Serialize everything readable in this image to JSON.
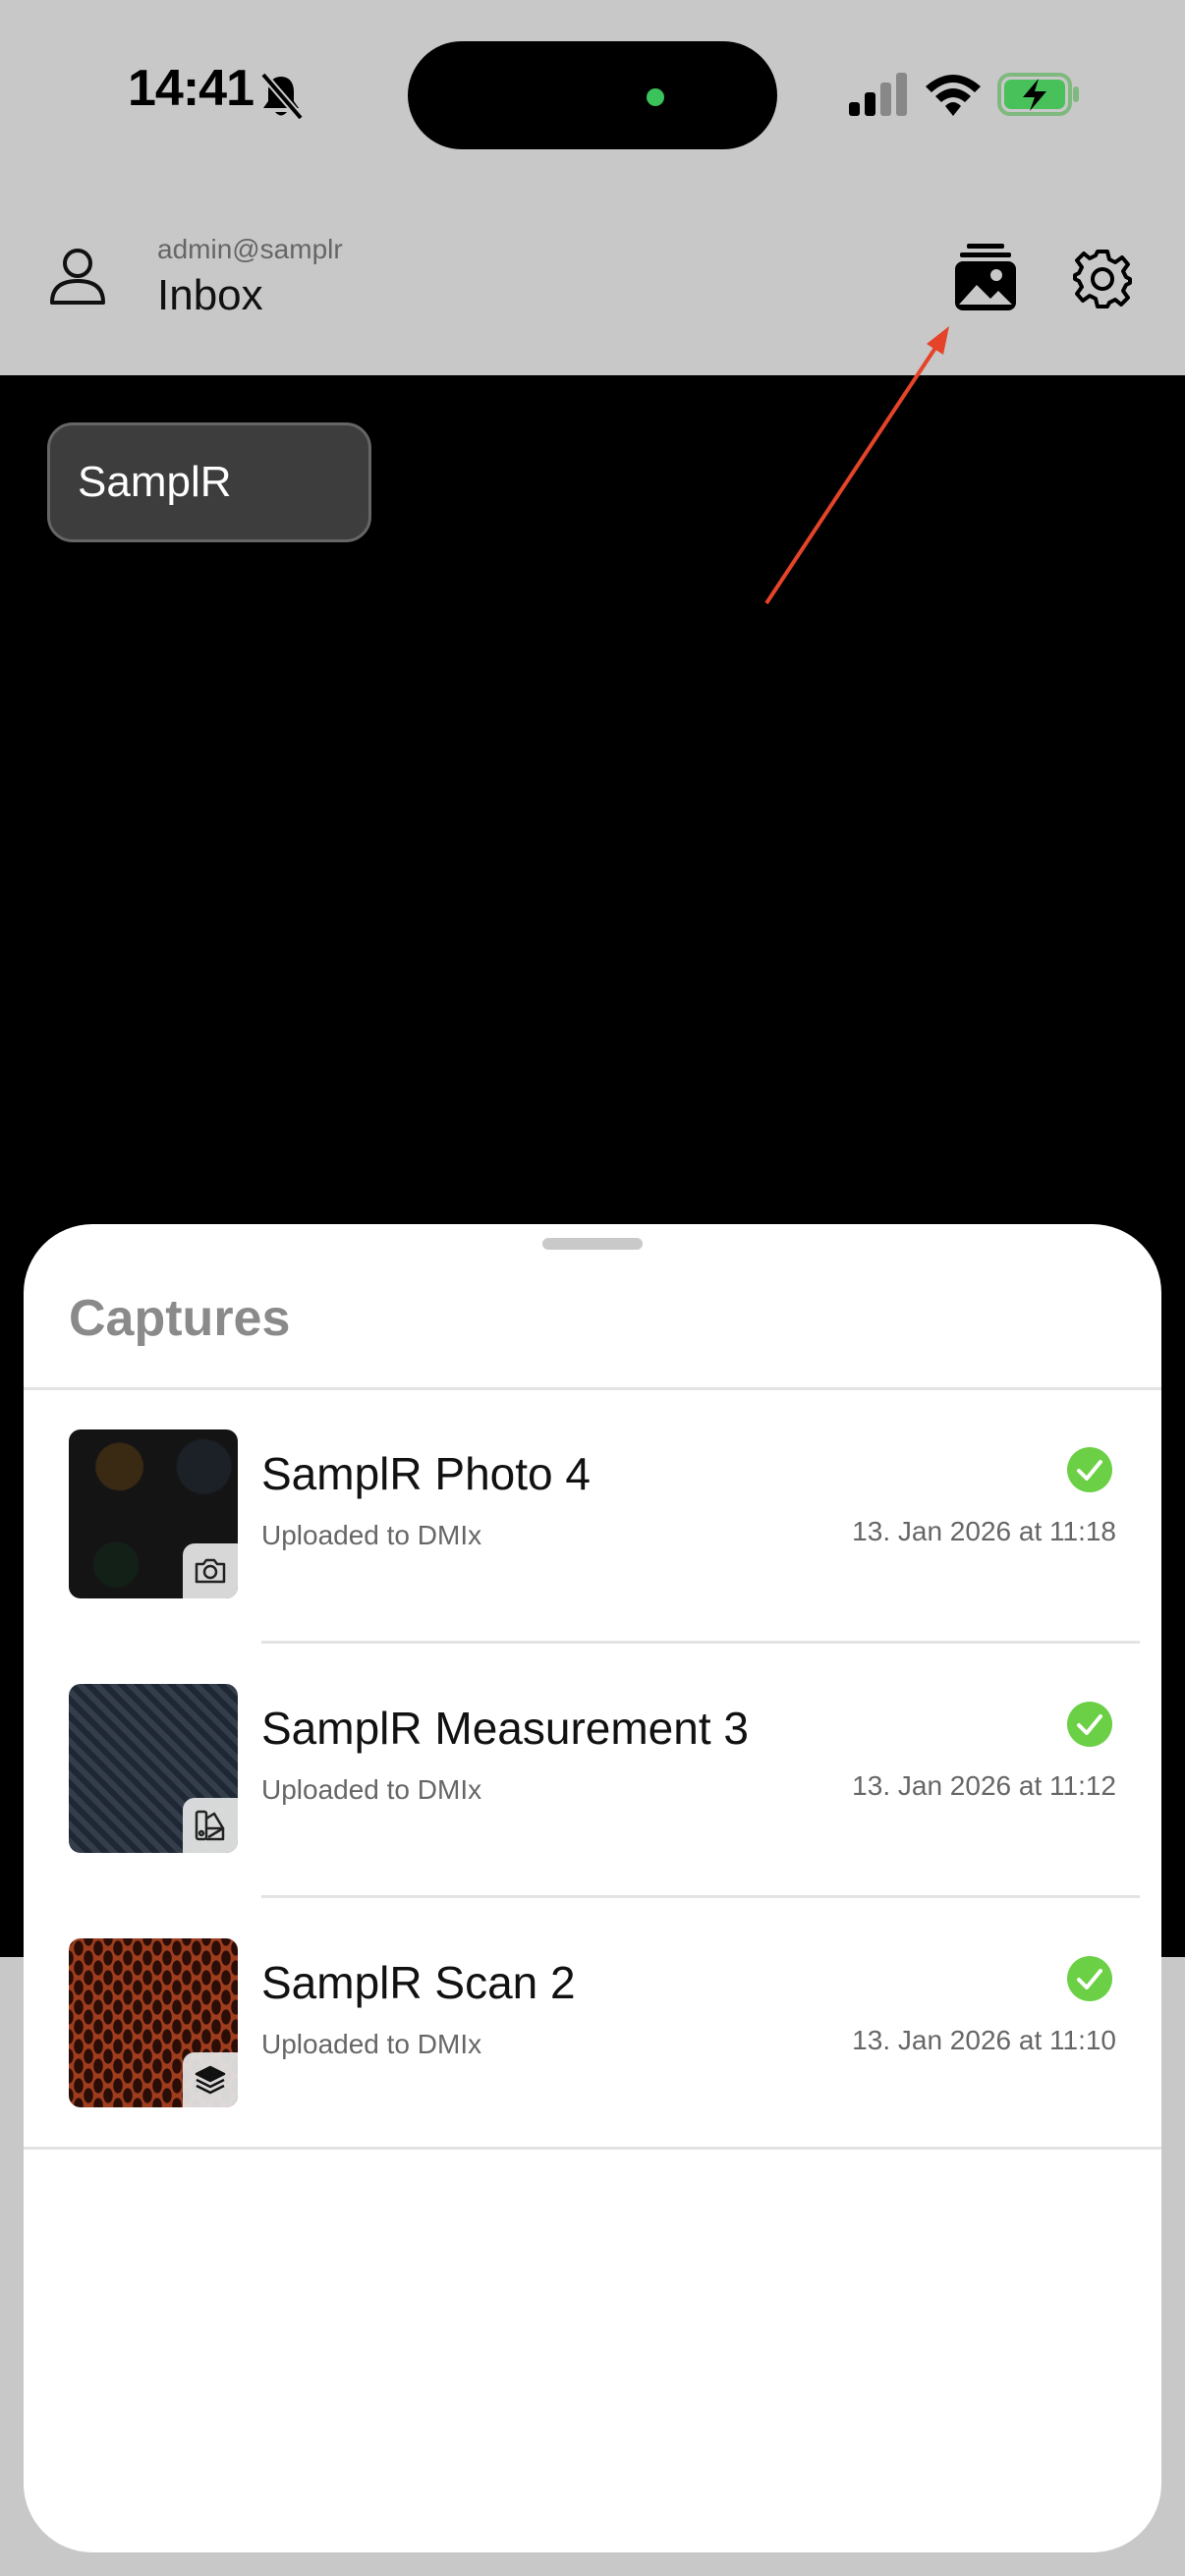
{
  "status_bar": {
    "time": "14:41",
    "icons": [
      "bell-slash-icon",
      "cellular-signal-icon",
      "wifi-icon",
      "battery-charging-icon"
    ],
    "colors": {
      "camera_dot": "#3ac35a",
      "battery": "#49c15b"
    }
  },
  "header": {
    "account": "admin@samplr",
    "title": "Inbox",
    "icons": [
      "user-icon",
      "gallery-icon",
      "gear-icon"
    ]
  },
  "camera": {
    "source_chip": "SamplR"
  },
  "sheet": {
    "title": "Captures",
    "items": [
      {
        "title": "SamplR Photo 4",
        "status": "Uploaded to DMIx",
        "date": "13. Jan 2026 at 11:18",
        "type_icon": "camera-icon"
      },
      {
        "title": "SamplR Measurement 3",
        "status": "Uploaded to DMIx",
        "date": "13. Jan 2026 at 11:12",
        "type_icon": "color-swatch-icon"
      },
      {
        "title": "SamplR Scan 2",
        "status": "Uploaded to DMIx",
        "date": "13. Jan 2026 at 11:10",
        "type_icon": "layers-icon"
      }
    ],
    "colors": {
      "check": "#6bd045",
      "annotation_arrow": "#e5432a"
    }
  }
}
